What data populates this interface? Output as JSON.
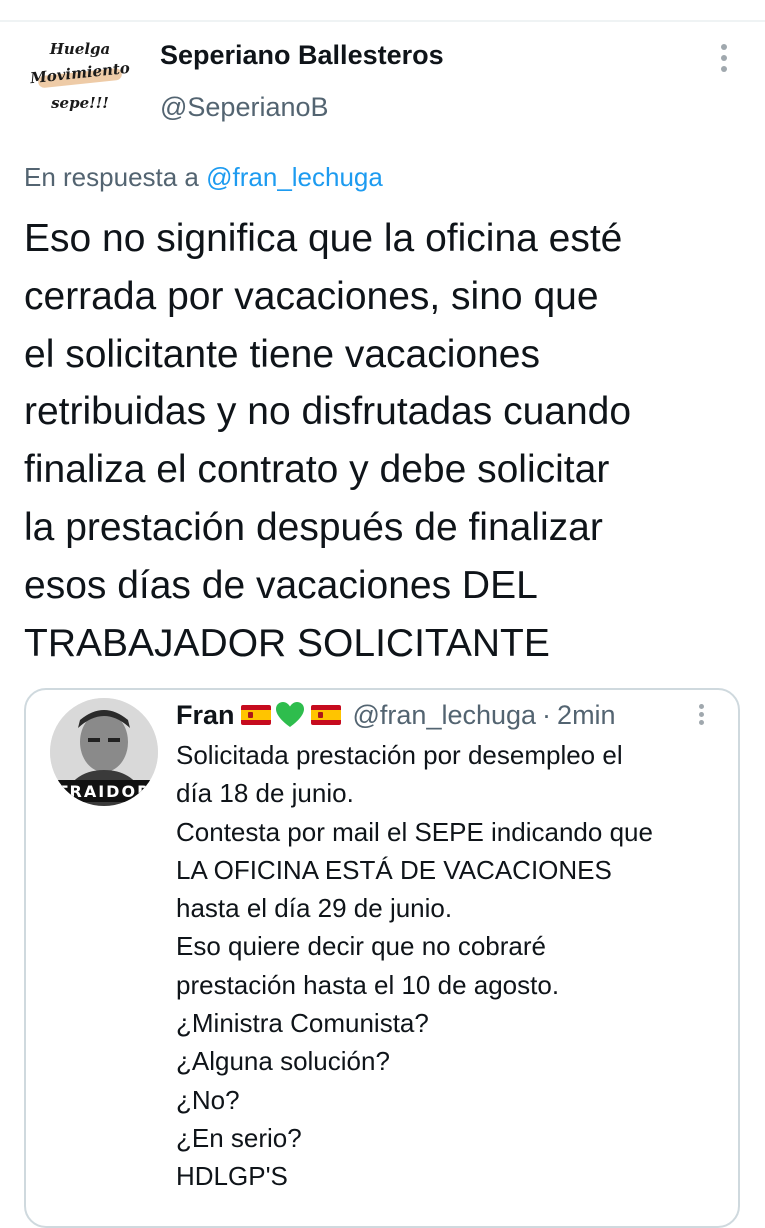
{
  "author": {
    "avatar_lines": [
      "Huelga",
      "Movimiento",
      "sepe!!!"
    ],
    "display_name": "Seperiano Ballesteros",
    "handle": "@SeperianoB"
  },
  "reply": {
    "prefix": "En respuesta a",
    "target": "@fran_lechuga"
  },
  "tweet": {
    "lines": [
      "Eso no significa que la oficina esté",
      "cerrada por vacaciones, sino que",
      "el solicitante tiene vacaciones",
      "retribuidas y no disfrutadas cuando",
      "finaliza el contrato y debe solicitar",
      "la prestación después de finalizar",
      "esos días de vacaciones DEL",
      "TRABAJADOR SOLICITANTE"
    ]
  },
  "quote": {
    "avatar_label": "TRAIDOR",
    "display_name": "Fran",
    "emoji_icons": [
      "spain-flag-icon",
      "green-heart-icon",
      "spain-flag-icon"
    ],
    "handle": "@fran_lechuga",
    "separator": "·",
    "time": "2min",
    "lines": [
      "Solicitada prestación por desempleo el",
      "día 18 de junio.",
      "Contesta por mail el SEPE indicando que",
      "LA OFICINA ESTÁ DE VACACIONES",
      "hasta el día 29 de junio.",
      "Eso quiere decir que no cobraré",
      "prestación hasta el 10 de agosto.",
      "¿Ministra Comunista?",
      "¿Alguna solución?",
      "¿No?",
      "¿En serio?",
      "HDLGP'S"
    ]
  },
  "colors": {
    "text": "#0f1419",
    "secondary": "#536471",
    "link": "#1d9bf0",
    "border": "#cfd9de",
    "heart": "#2ebd4d"
  }
}
